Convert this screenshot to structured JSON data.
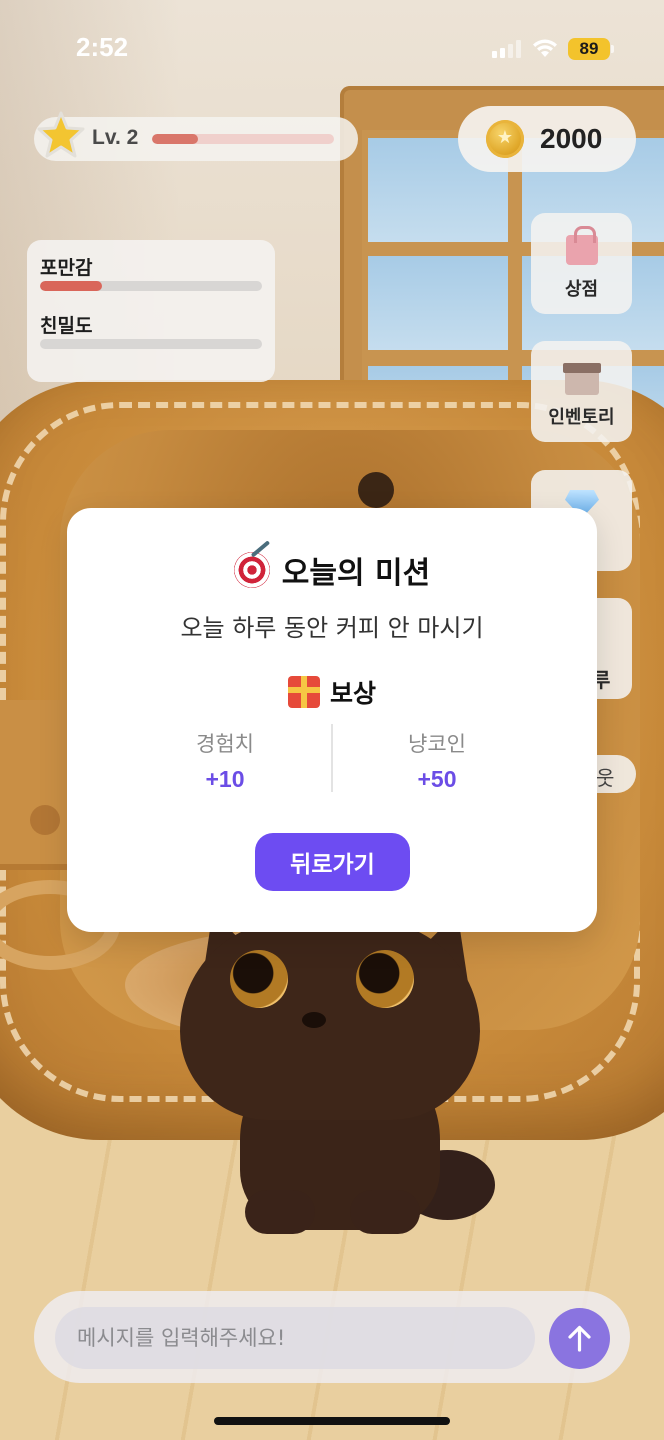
{
  "status_bar": {
    "time": "2:52",
    "battery": "89"
  },
  "hud": {
    "level_label": "Lv. 2",
    "xp_progress": 0.25,
    "coins": "2000"
  },
  "stats": [
    {
      "label": "포만감",
      "value": 0.28
    },
    {
      "label": "친밀도",
      "value": 0.0
    }
  ],
  "side_menu": {
    "shop_label": "상점",
    "inventory_label": "인벤토리",
    "partial_label": "루",
    "partial_pill_text": "웃"
  },
  "mission_modal": {
    "title": "오늘의 미션",
    "description": "오늘 하루 동안 커피 안 마시기",
    "reward_title": "보상",
    "rewards": [
      {
        "label": "경험치",
        "value": "+10"
      },
      {
        "label": "냥코인",
        "value": "+50"
      }
    ],
    "back_button": "뒤로가기"
  },
  "chat": {
    "placeholder": "메시지를 입력해주세요!"
  },
  "colors": {
    "accent": "#6d4cf2",
    "reward_value": "#6b4de6",
    "stat_fill": "#d9665a",
    "battery": "#f3c32c"
  },
  "icons": [
    "star-icon",
    "coin-icon",
    "shopping-bag-icon",
    "box-icon",
    "gem-icon",
    "target-icon",
    "gift-icon",
    "arrow-up-icon"
  ]
}
